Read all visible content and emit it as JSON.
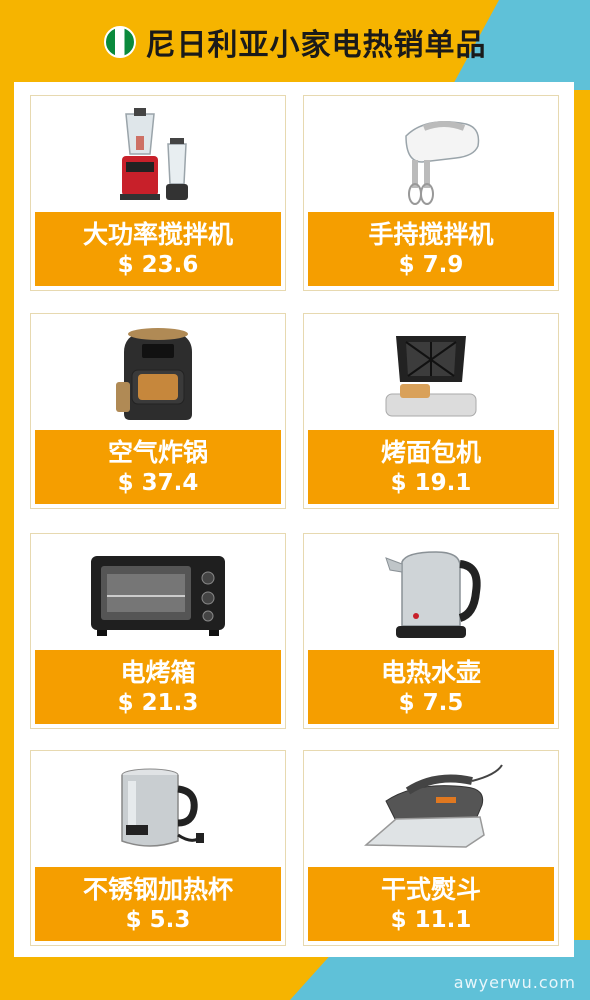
{
  "header": {
    "title": "尼日利亚小家电热销单品",
    "flag_icon": "nigeria-flag-icon"
  },
  "products": [
    {
      "name": "大功率搅拌机",
      "price": "$ 23.6",
      "icon": "blender-icon"
    },
    {
      "name": "手持搅拌机",
      "price": "$ 7.9",
      "icon": "hand-mixer-icon"
    },
    {
      "name": "空气炸锅",
      "price": "$ 37.4",
      "icon": "air-fryer-icon"
    },
    {
      "name": "烤面包机",
      "price": "$ 19.1",
      "icon": "sandwich-maker-icon"
    },
    {
      "name": "电烤箱",
      "price": "$ 21.3",
      "icon": "oven-icon"
    },
    {
      "name": "电热水壶",
      "price": "$ 7.5",
      "icon": "kettle-icon"
    },
    {
      "name": "不锈钢加热杯",
      "price": "$ 5.3",
      "icon": "heating-cup-icon"
    },
    {
      "name": "干式熨斗",
      "price": "$ 11.1",
      "icon": "iron-icon"
    }
  ],
  "watermark": "awyerwu.com",
  "colors": {
    "accent": "#f59e00",
    "background": "#f6b400",
    "secondary": "#5fc1d8"
  }
}
